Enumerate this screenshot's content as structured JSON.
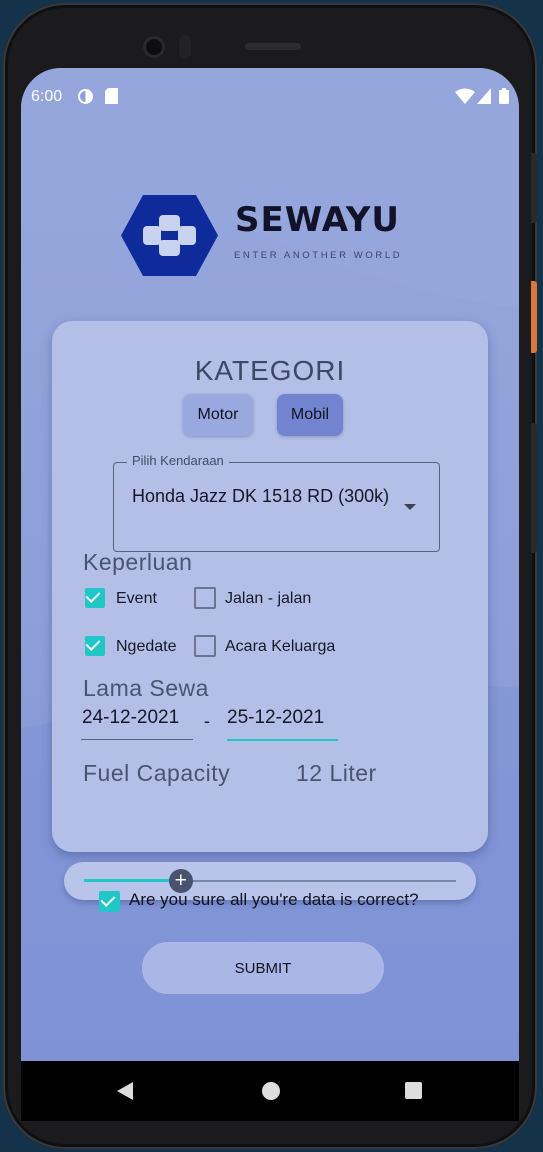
{
  "status_bar": {
    "time": "6:00"
  },
  "brand": {
    "name": "SEWAYU",
    "tagline": "ENTER ANOTHER WORLD"
  },
  "card": {
    "title": "KATEGORI",
    "chips": [
      {
        "label": "Motor",
        "selected": false
      },
      {
        "label": "Mobil",
        "selected": true
      }
    ],
    "vehicle_select": {
      "label": "Pilih Kendaraan",
      "value": "Honda Jazz DK 1518 RD (300k)"
    },
    "purpose": {
      "title": "Keperluan",
      "options": [
        {
          "label": "Event",
          "checked": true
        },
        {
          "label": "Jalan - jalan",
          "checked": false
        },
        {
          "label": "Ngedate",
          "checked": true
        },
        {
          "label": "Acara Keluarga",
          "checked": false
        }
      ]
    },
    "rental": {
      "title": "Lama Sewa",
      "start": "24-12-2021",
      "separator": "-",
      "end": "25-12-2021"
    },
    "fuel": {
      "title": "Fuel Capacity",
      "value_text": "12 Liter",
      "slider_fraction": 0.26,
      "thumb_symbol": "+"
    }
  },
  "confirm": {
    "label": "Are you sure all you're data is correct?",
    "checked": true
  },
  "submit_label": "SUBMIT",
  "colors": {
    "accent": "#21c6c6",
    "card": "#b3bfe7",
    "logo": "#0f2a9a"
  }
}
